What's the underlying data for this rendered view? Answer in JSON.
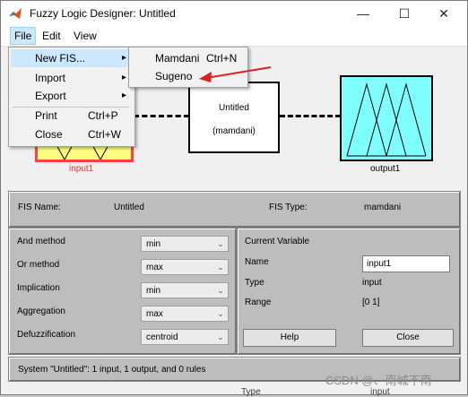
{
  "window": {
    "title": "Fuzzy Logic Designer: Untitled"
  },
  "menubar": {
    "items": [
      "File",
      "Edit",
      "View"
    ]
  },
  "file_menu": {
    "items": [
      {
        "label": "New FIS...",
        "shortcut": "",
        "submenu": true
      },
      {
        "label": "Import",
        "shortcut": "",
        "submenu": true
      },
      {
        "label": "Export",
        "shortcut": "",
        "submenu": true
      },
      {
        "label": "Print",
        "shortcut": "Ctrl+P",
        "submenu": false
      },
      {
        "label": "Close",
        "shortcut": "Ctrl+W",
        "submenu": false
      }
    ]
  },
  "new_fis_submenu": {
    "items": [
      {
        "label": "Mamdani",
        "shortcut": "Ctrl+N"
      },
      {
        "label": "Sugeno",
        "shortcut": ""
      }
    ]
  },
  "diagram": {
    "input_label": "input1",
    "fis_name": "Untitled",
    "fis_type_paren": "(mamdani)",
    "output_label": "output1",
    "input_color": "#ffff80",
    "input_border": "#ff4040",
    "output_color": "#80ffff"
  },
  "info": {
    "fis_name_label": "FIS Name:",
    "fis_name_value": "Untitled",
    "fis_type_label": "FIS Type:",
    "fis_type_value": "mamdani"
  },
  "methods": [
    {
      "label": "And method",
      "value": "min"
    },
    {
      "label": "Or method",
      "value": "max"
    },
    {
      "label": "Implication",
      "value": "min"
    },
    {
      "label": "Aggregation",
      "value": "max"
    },
    {
      "label": "Defuzzification",
      "value": "centroid"
    }
  ],
  "current_variable": {
    "heading": "Current Variable",
    "name_label": "Name",
    "name_value": "input1",
    "type_label": "Type",
    "type_value": "input",
    "range_label": "Range",
    "range_value": "[0 1]"
  },
  "buttons": {
    "help": "Help",
    "close": "Close"
  },
  "status": "System \"Untitled\": 1 input, 1 output, and 0 rules",
  "watermark": "CSDN @、南城不南",
  "peek": {
    "type_label": "Type",
    "type_value": "input"
  }
}
